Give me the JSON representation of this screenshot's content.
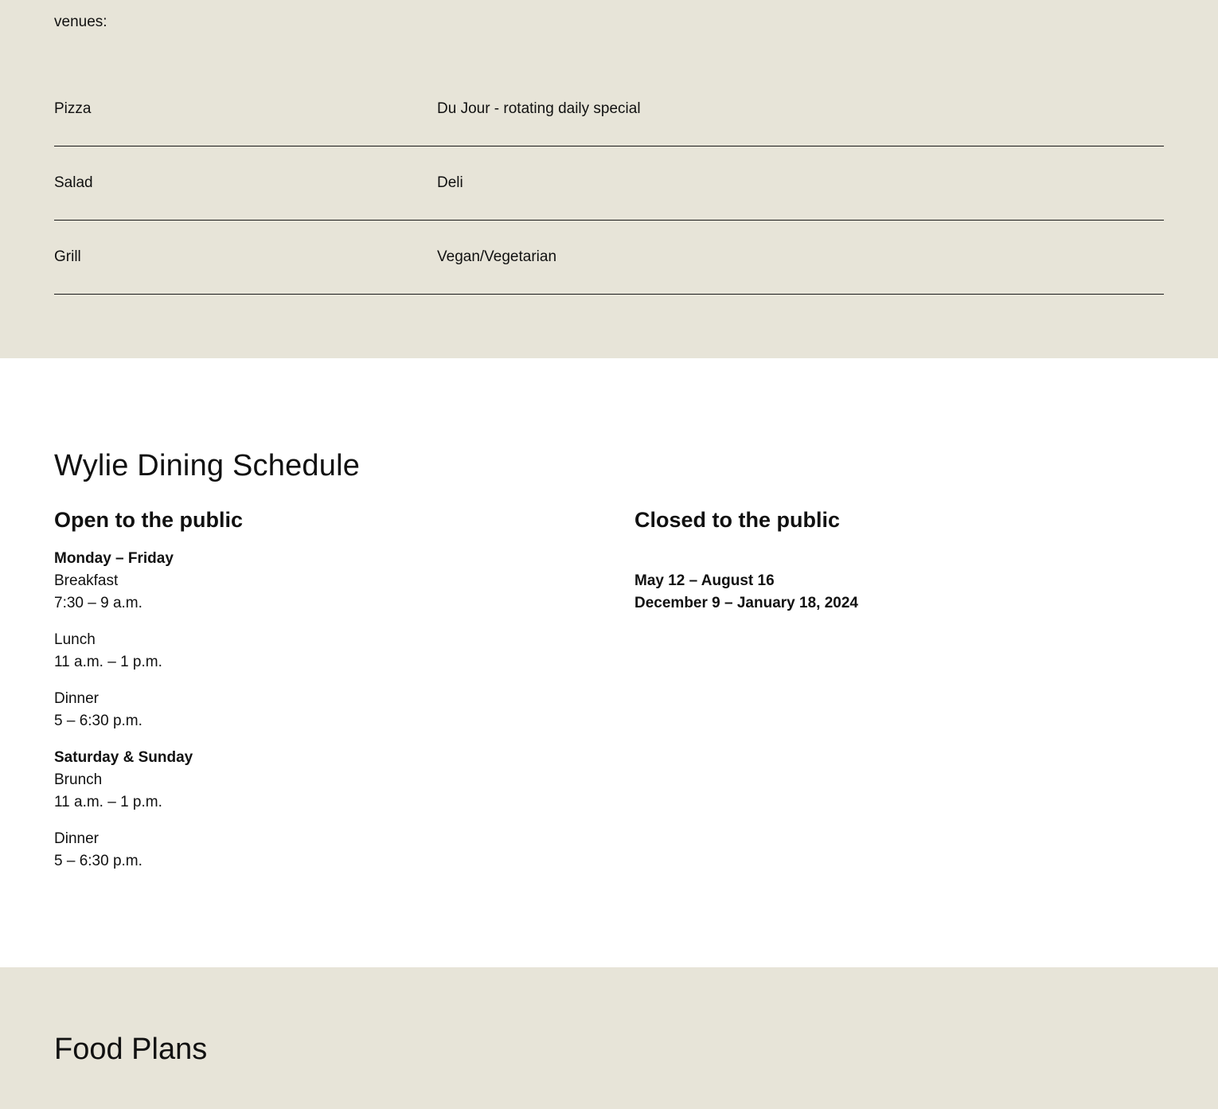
{
  "venues": {
    "intro_line": "venues:",
    "rows": [
      {
        "left": "Pizza",
        "right": "Du Jour - rotating daily special"
      },
      {
        "left": "Salad",
        "right": "Deli"
      },
      {
        "left": "Grill",
        "right": "Vegan/Vegetarian"
      }
    ]
  },
  "schedule": {
    "title": "Wylie Dining Schedule",
    "open": {
      "heading": "Open to the public",
      "weekday": {
        "label": "Monday – Friday",
        "meals": [
          {
            "name": "Breakfast",
            "time": "7:30 – 9 a.m."
          },
          {
            "name": "Lunch",
            "time": "11 a.m. – 1 p.m."
          },
          {
            "name": "Dinner",
            "time": "5 – 6:30 p.m."
          }
        ]
      },
      "weekend": {
        "label": "Saturday & Sunday",
        "meals": [
          {
            "name": "Brunch",
            "time": "11 a.m. – 1 p.m."
          },
          {
            "name": "Dinner",
            "time": "5 – 6:30 p.m."
          }
        ]
      }
    },
    "closed": {
      "heading": "Closed to the public",
      "dates": [
        "May 12 – August 16",
        "December 9 – January 18, 2024"
      ]
    }
  },
  "food_plans": {
    "title": "Food Plans"
  },
  "colors": {
    "beige": "#e7e4d8",
    "text": "#111111"
  }
}
